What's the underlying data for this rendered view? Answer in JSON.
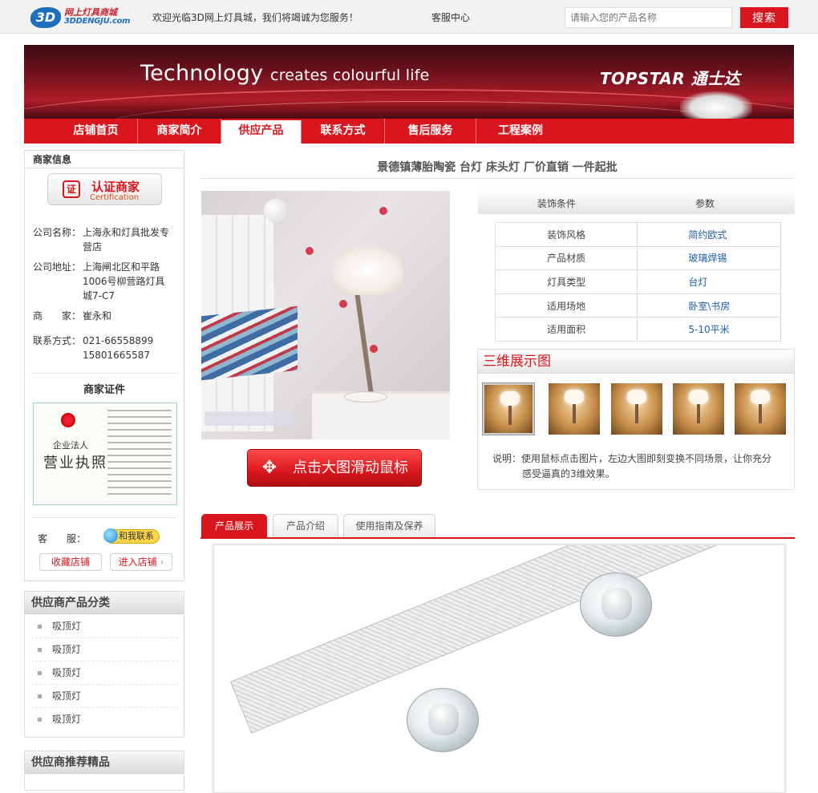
{
  "topbar": {
    "logo_cn": "网上灯具商城",
    "logo_en": "3DDENGJU.com",
    "logo_mark": "3D",
    "welcome": "欢迎光临3D网上灯具城，我们将竭诚为您服务！",
    "service_center": "客服中心",
    "search_placeholder": "请输入您的产品名称",
    "search_button": "搜索"
  },
  "banner": {
    "tagline_big": "Technology",
    "tagline_small": "creates colourful life",
    "brand": "TOPSTAR 通士达"
  },
  "nav": {
    "items": [
      {
        "label": "店铺首页",
        "active": false
      },
      {
        "label": "商家简介",
        "active": false
      },
      {
        "label": "供应产品",
        "active": true
      },
      {
        "label": "联系方式",
        "active": false
      },
      {
        "label": "售后服务",
        "active": false
      },
      {
        "label": "工程案例",
        "active": false
      }
    ]
  },
  "merchant": {
    "heading": "商家信息",
    "cert_seal": "证",
    "cert_label": "认证商家",
    "cert_label_en": "Certification",
    "company_label": "公司名称：",
    "company_value": "上海永和灯具批发专营店",
    "address_label": "公司地址：",
    "address_value": "上海闸北区和平路1006号柳营路灯具城7-C7",
    "owner_label": "商　　家：",
    "owner_value": "崔永和",
    "phone_label": "联系方式：",
    "phone_value_1": "021-66558899",
    "phone_value_2": "15801665587",
    "license_heading": "商家证件",
    "license_text_1": "企业法人",
    "license_text_2": "营业执照",
    "service_label": "客　　服：",
    "contact_chip": "和我联系",
    "favorite_button": "收藏店铺",
    "enter_button": "进入店铺"
  },
  "categories": {
    "heading": "供应商产品分类",
    "items": [
      "吸顶灯",
      "吸顶灯",
      "吸顶灯",
      "吸顶灯",
      "吸顶灯"
    ]
  },
  "recommend": {
    "heading": "供应商推荐精品"
  },
  "product": {
    "title": "景德镇薄胎陶瓷 台灯 床头灯 厂价直销 一件起批",
    "drag_button": "点击大图滑动鼠标",
    "drag_icon": "move-arrows-icon"
  },
  "specs": {
    "col1": "装饰条件",
    "col2": "参数",
    "rows": [
      {
        "key": "装饰风格",
        "value": "简约欧式"
      },
      {
        "key": "产品材质",
        "value": "玻璃焊锡"
      },
      {
        "key": "灯具类型",
        "value": "台灯"
      },
      {
        "key": "适用场地",
        "value": "卧室\\书房"
      },
      {
        "key": "适用面积",
        "value": "5-10平米"
      }
    ]
  },
  "view3d": {
    "heading": "三维展示图",
    "note_line1": "说明：使用鼠标点击图片，左边大图即刻变换不同场景，让你充分",
    "note_line2": "感受逼真的3维效果。",
    "thumb_count": 5
  },
  "tabs": {
    "items": [
      {
        "label": "产品展示",
        "active": true
      },
      {
        "label": "产品介绍",
        "active": false
      },
      {
        "label": "使用指南及保养",
        "active": false
      }
    ]
  },
  "colors": {
    "brand_red": "#d9161d",
    "link_blue": "#1f5fa8"
  }
}
